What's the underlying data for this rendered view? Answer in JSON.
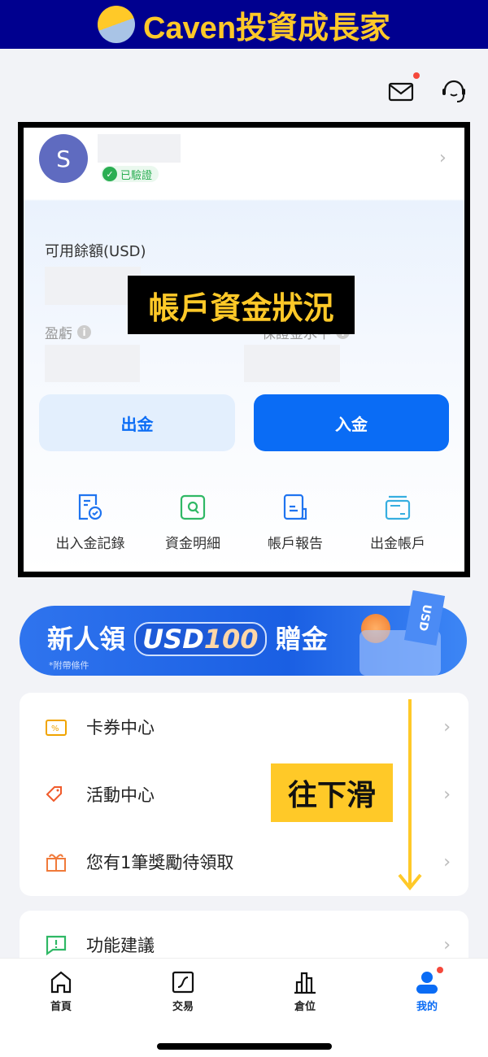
{
  "watermark": {
    "title": "Caven投資成長家"
  },
  "header": {
    "mail_icon": "mail-icon",
    "support_icon": "headset-icon"
  },
  "profile": {
    "avatar_letter": "S",
    "verified": "已驗證"
  },
  "balance": {
    "available_label": "可用餘額(USD)",
    "pnl_label": "盈虧",
    "margin_label": "保證金水平"
  },
  "actions": {
    "withdraw": "出金",
    "deposit": "入金"
  },
  "quick": [
    {
      "label": "出入金記錄",
      "icon": "receipt-check-icon"
    },
    {
      "label": "資金明細",
      "icon": "search-doc-icon"
    },
    {
      "label": "帳戶報告",
      "icon": "report-icon"
    },
    {
      "label": "出金帳戶",
      "icon": "card-icon"
    }
  ],
  "annotations": {
    "account": "帳戶資金狀況",
    "scroll": "往下滑"
  },
  "promo": {
    "prefix": "新人領",
    "usd": "USD",
    "amount": "100",
    "suffix": "贈金",
    "note": "*附帶條件",
    "tag": "USD"
  },
  "menu": [
    {
      "label": "卡券中心"
    },
    {
      "label": "活動中心"
    },
    {
      "label": "您有1筆獎勵待領取"
    }
  ],
  "menu2": [
    {
      "label": "功能建議"
    }
  ],
  "nav": [
    {
      "label": "首頁"
    },
    {
      "label": "交易"
    },
    {
      "label": "倉位"
    },
    {
      "label": "我的",
      "active": true
    }
  ],
  "colors": {
    "accent": "#0a6cf5",
    "annotation": "#ffc928",
    "banner": "#00008f"
  }
}
